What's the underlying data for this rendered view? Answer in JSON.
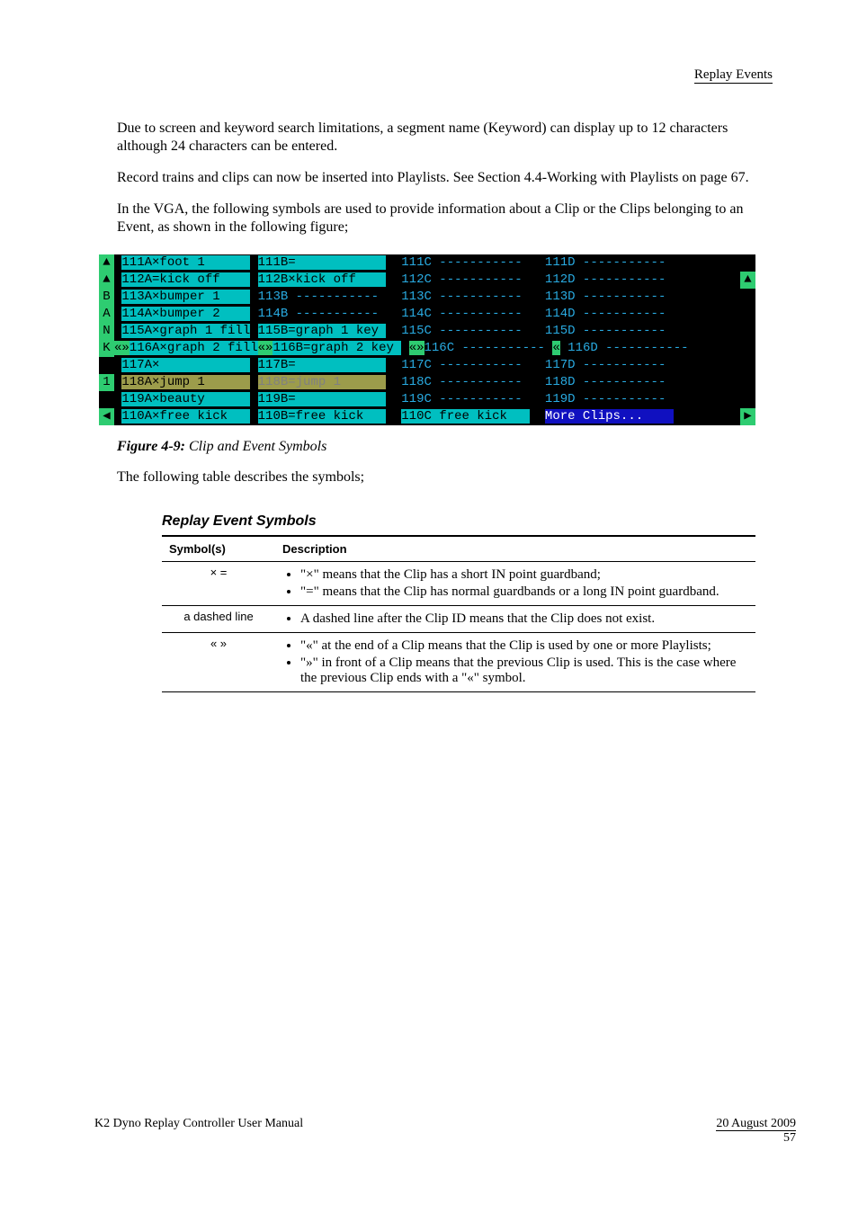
{
  "header_right": "Replay Events",
  "para1": "Due to screen and keyword search limitations, a segment name (Keyword) can display up to 12 characters although 24 characters can be entered.",
  "para2": "Record trains and clips can now be inserted into Playlists. See Section 4.4-Working with Playlists on page 67.",
  "para3": "In the VGA, the following symbols are used to provide information about a Clip or the Clips belonging to an Event, as shown in the following figure;",
  "figure_label": "Figure 4-9:",
  "figure_rest": " Clip and Event Symbols",
  "rows": [
    {
      "l": "▲",
      "la": "111A×foot 1",
      "ma": "",
      "lb": "111B=",
      "mb": "",
      "c": "111C -----------",
      "d": "111D -----------",
      "r": "",
      "css_a": "bk-cyan",
      "css_b": "bk-cyan"
    },
    {
      "l": "▲",
      "la": "112A=kick off",
      "ma": "",
      "lb": "112B×kick off",
      "mb": "",
      "c": "112C -----------",
      "d": "112D -----------",
      "r": "▲",
      "css_a": "bk-cyan",
      "css_b": "bk-cyan"
    },
    {
      "l": "B",
      "la": "113A×bumper 1",
      "ma": "",
      "lb": "113B -----------",
      "mb": "",
      "c": "113C -----------",
      "d": "113D -----------",
      "r": "",
      "css_a": "bk-cyan",
      "css_b": ""
    },
    {
      "l": "A",
      "la": "114A×bumper 2",
      "ma": "",
      "lb": "114B -----------",
      "mb": "",
      "c": "114C -----------",
      "d": "114D -----------",
      "r": "",
      "css_a": "bk-cyan",
      "css_b": ""
    },
    {
      "l": "N",
      "la": "115A×graph 1 fill",
      "ma": "",
      "lb": "115B=graph 1 key",
      "mb": "",
      "c": "115C -----------",
      "d": "115D -----------",
      "r": "",
      "css_a": "bk-cyan",
      "css_b": "bk-cyan"
    },
    {
      "l": "K",
      "la": "116A×graph 2 fill",
      "ma": "«»",
      "lb": "116B=graph 2 key",
      "mb": "«»",
      "c": "116C -----------",
      "mc": "«»",
      "d": "116D -----------",
      "md": "«",
      "r": "",
      "css_a": "bk-cyan",
      "css_b": "bk-cyan",
      "mark": true
    },
    {
      "l": "",
      "la": "117A×",
      "ma": "",
      "lb": "117B=",
      "mb": "",
      "c": "117C -----------",
      "d": "117D -----------",
      "r": "",
      "css_a": "bk-cyan",
      "css_b": "bk-cyan"
    },
    {
      "l": "1",
      "la": "118A×jump 1",
      "ma": "",
      "lb": "118B=jump 1",
      "mb": "",
      "c": "118C -----------",
      "d": "118D -----------",
      "r": "",
      "css_a": "bk-olive",
      "css_b": "bk-olive",
      "grey": true
    },
    {
      "l": "",
      "la": "119A×beauty",
      "ma": "",
      "lb": "119B=",
      "mb": "",
      "c": "119C -----------",
      "d": "119D -----------",
      "r": "",
      "css_a": "bk-cyan",
      "css_b": "bk-cyan"
    },
    {
      "l": "◀",
      "la": "110A×free kick",
      "ma": "",
      "lb": "110B=free kick",
      "mb": "",
      "c": "110C free kick",
      "d": "More Clips...",
      "r": "▶",
      "css_a": "bk-cyan",
      "css_b": "bk-cyan",
      "css_c": "bk-cyan",
      "css_d": "bk-blue"
    }
  ],
  "para4": "The following table describes the symbols;",
  "table_title": "Replay Event Symbols",
  "col1": "Symbol(s)",
  "col2": "Description",
  "entries": [
    {
      "sym": "×    =",
      "desc": [
        "\"×\" means that the Clip has a short IN point guardband;",
        "\"=\" means that the Clip has normal guardbands or a long IN point guardband."
      ]
    },
    {
      "sym": "a dashed line",
      "desc": [
        "A dashed line after the Clip ID means that the Clip does not exist."
      ]
    },
    {
      "sym": "«    »",
      "desc": [
        "\"«\" at the end of a Clip means that the Clip is used by one or more Playlists;",
        "\"»\" in front of a Clip means that the previous Clip is used. This is the case where the previous Clip ends with a \"«\" symbol."
      ]
    }
  ],
  "footer_left": "K2 Dyno Replay Controller User Manual",
  "footer_right_date": "20 August 2009",
  "footer_page": "57"
}
